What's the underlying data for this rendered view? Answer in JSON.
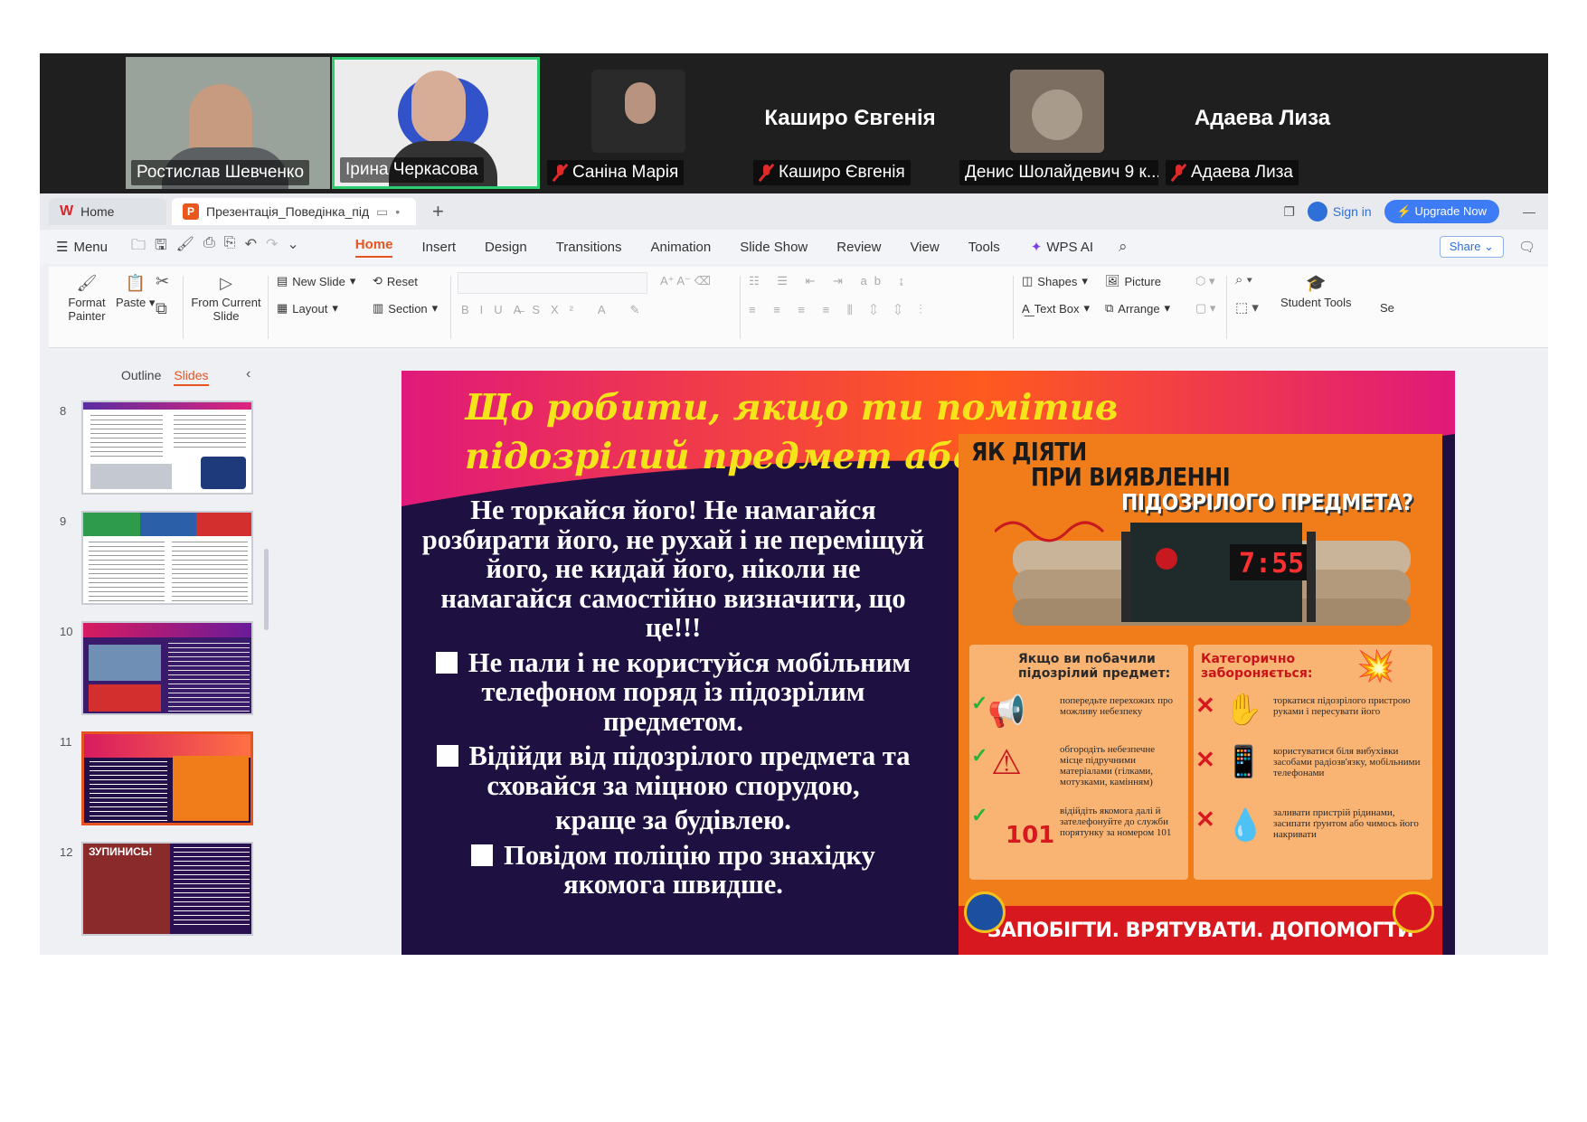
{
  "participants": [
    {
      "name": "Ростислав Шевченко",
      "muted": false,
      "has_video": true
    },
    {
      "name": "Ірина Черкасова",
      "muted": false,
      "has_video": true,
      "speaking": true
    },
    {
      "name": "Саніна Марія",
      "muted": true,
      "has_video": true
    },
    {
      "name": "Каширо Євгенія",
      "muted": true,
      "has_video": false
    },
    {
      "name": "Денис Шолайдевич 9 к...",
      "muted": false,
      "has_video": true
    },
    {
      "name": "Адаева Лиза",
      "muted": true,
      "has_video": false
    }
  ],
  "tabs": {
    "home": "Home",
    "document": "Презентація_Поведінка_під"
  },
  "window": {
    "sign_in": "Sign in",
    "upgrade": "Upgrade Now"
  },
  "menu": {
    "menu_label": "Menu",
    "items": [
      "Home",
      "Insert",
      "Design",
      "Transitions",
      "Animation",
      "Slide Show",
      "Review",
      "View",
      "Tools"
    ],
    "active": "Home",
    "wps_ai": "WPS AI",
    "share": "Share"
  },
  "ribbon": {
    "format_painter": "Format Painter",
    "paste": "Paste",
    "from_current_slide": "From Current Slide",
    "new_slide": "New Slide",
    "layout": "Layout",
    "reset": "Reset",
    "section": "Section",
    "shapes": "Shapes",
    "picture": "Picture",
    "text_box": "Text Box",
    "arrange": "Arrange",
    "student_tools": "Student Tools",
    "se": "Se"
  },
  "panel": {
    "outline": "Outline",
    "slides": "Slides",
    "slide_numbers": [
      "8",
      "9",
      "10",
      "11",
      "12"
    ],
    "selected": "11",
    "thumb_12_heading": "ЗУПИНИСЬ!"
  },
  "slide": {
    "title": "Що робити, якщо ти помітив підозрілий предмет або вибухівку?",
    "paragraphs": [
      "Не торкайся його! Не намагайся розбирати його, не рухай і не переміщуй його, не кидай його, ніколи не намагайся самостійно визначити, що це!!!",
      "Не пали і не користуйся мобільним телефоном поряд із підозрілим предметом.",
      "Відійди від підозрілого предмета та сховайся за міцною спорудою,",
      "краще за будівлею.",
      "Повідом поліцію про знахідку якомога швидше."
    ],
    "bulleted": [
      false,
      true,
      true,
      false,
      true
    ]
  },
  "poster": {
    "line1": "ЯК ДІЯТИ",
    "line2": "ПРИ ВИЯВЛЕННІ",
    "line3": "ПІДОЗРІЛОГО ПРЕДМЕТА?",
    "timer": "7:55",
    "left_head": "Якщо ви побачили підозрілий предмет:",
    "right_head": "Категорично забороняється:",
    "left_items": [
      "попередьте перехожих про можливу небезпеку",
      "обгородіть небезпечне місце підручними матеріалами (гілками, мотузками, камінням)",
      "відійдіть якомога далі й зателефонуйте до служби порятунку за номером 101"
    ],
    "right_items": [
      "торкатися підозрілого пристрою руками і пересувати його",
      "користуватися біля вибухівки засобами радіозв'язку, мобільними телефонами",
      "заливати пристрій рідинами, засипати ґрунтом або чимось його накривати"
    ],
    "number": "101",
    "footer": "ЗАПОБІГТИ. ВРЯТУВАТИ. ДОПОМОГТИ",
    "colors": {
      "orange": "#f07d1a",
      "red": "#d7191f",
      "panel": "#f9b372"
    }
  },
  "colors": {
    "accent": "#e65520",
    "slide_bg": "#1e1142",
    "title": "#f5e41a"
  }
}
